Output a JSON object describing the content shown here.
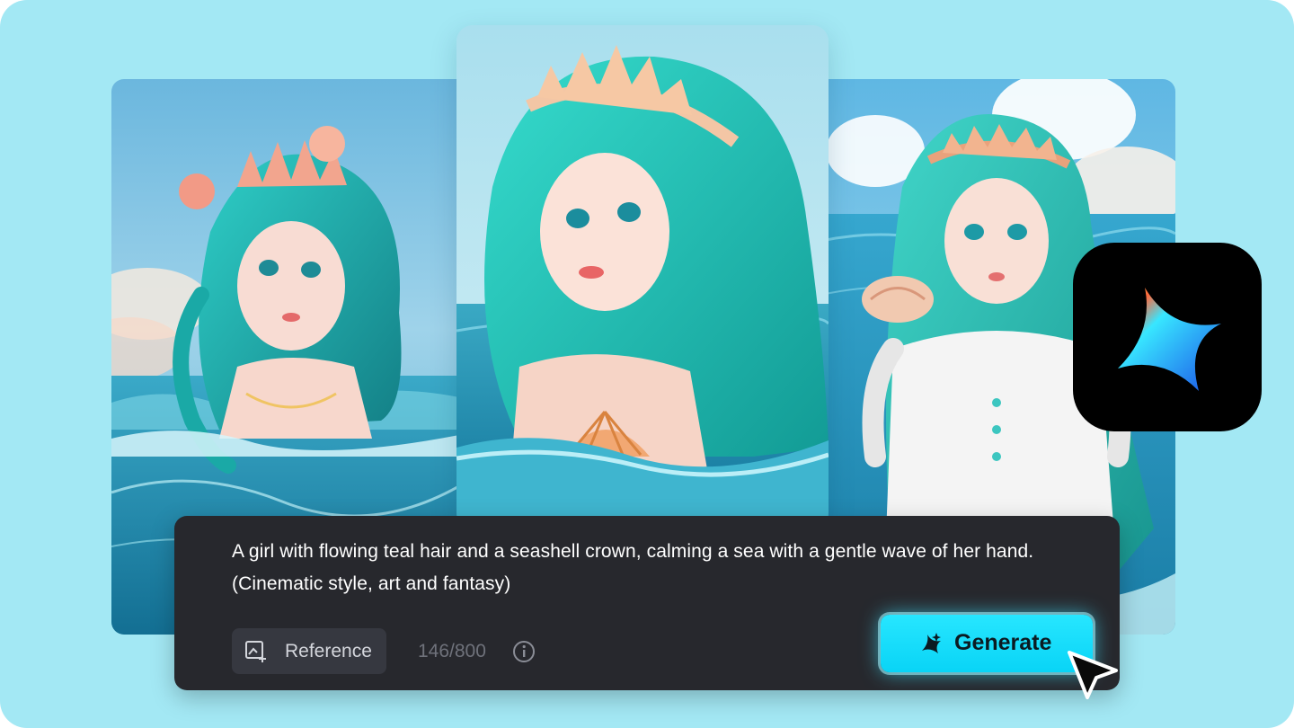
{
  "prompt": {
    "text": "A girl with flowing teal hair and a seashell crown, calming a sea with a gentle wave of her hand. (Cinematic style, art and fantasy)"
  },
  "toolbar": {
    "reference_label": "Reference",
    "char_count": "146/800",
    "generate_label": "Generate"
  },
  "gallery": {
    "images": [
      "mermaid-artwork-left",
      "mermaid-artwork-center",
      "mermaid-artwork-right"
    ]
  },
  "icons": {
    "reference": "image-add-icon",
    "info": "info-icon",
    "generate": "sparkle-icon",
    "app": "app-logo-icon",
    "cursor": "mouse-pointer-icon"
  },
  "colors": {
    "background": "#a3e8f4",
    "panel": "#27282d",
    "accent": "#12dcfb",
    "muted_text": "#6f727b"
  }
}
